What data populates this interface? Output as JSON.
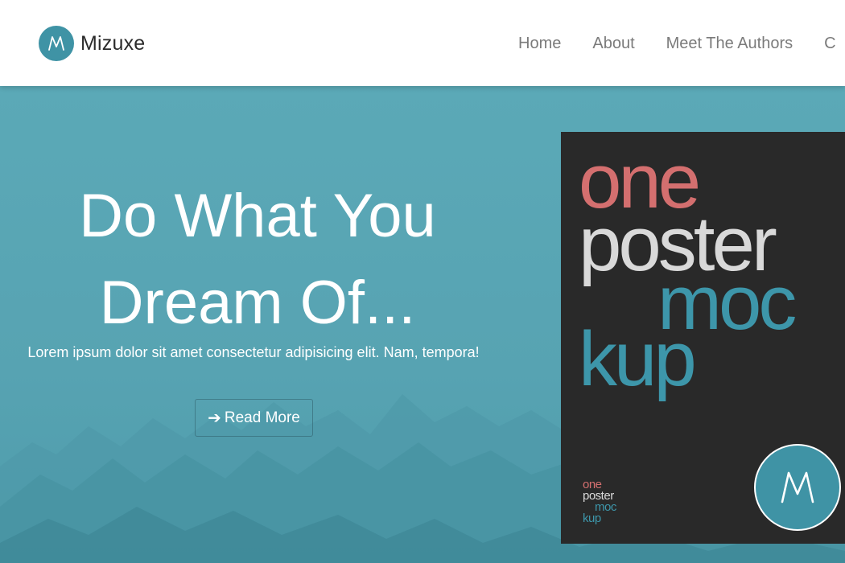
{
  "brand": {
    "name": "Mizuxe",
    "logo_letter": "M",
    "logo_color": "#3f93a5"
  },
  "nav": {
    "links": [
      {
        "label": "Home"
      },
      {
        "label": "About"
      },
      {
        "label": "Meet The Authors"
      },
      {
        "label": "C"
      }
    ]
  },
  "hero": {
    "title_line1": "Do What You",
    "title_line2": "Dream Of...",
    "subtitle": "Lorem ipsum dolor sit amet consectetur adipisicing elit. Nam, tempora!",
    "button_label": "Read More",
    "button_icon": "arrow-right-icon",
    "background_color": "#5aa6b4"
  },
  "poster": {
    "words": [
      "one",
      "poster",
      "moc",
      "kup"
    ],
    "mini_words": [
      "one",
      "poster",
      "moc",
      "kup"
    ],
    "badge_letter": "M",
    "colors": {
      "background": "#292929",
      "pink": "#d46f6f",
      "light": "#d9d9d9",
      "teal": "#3d96aa"
    }
  }
}
